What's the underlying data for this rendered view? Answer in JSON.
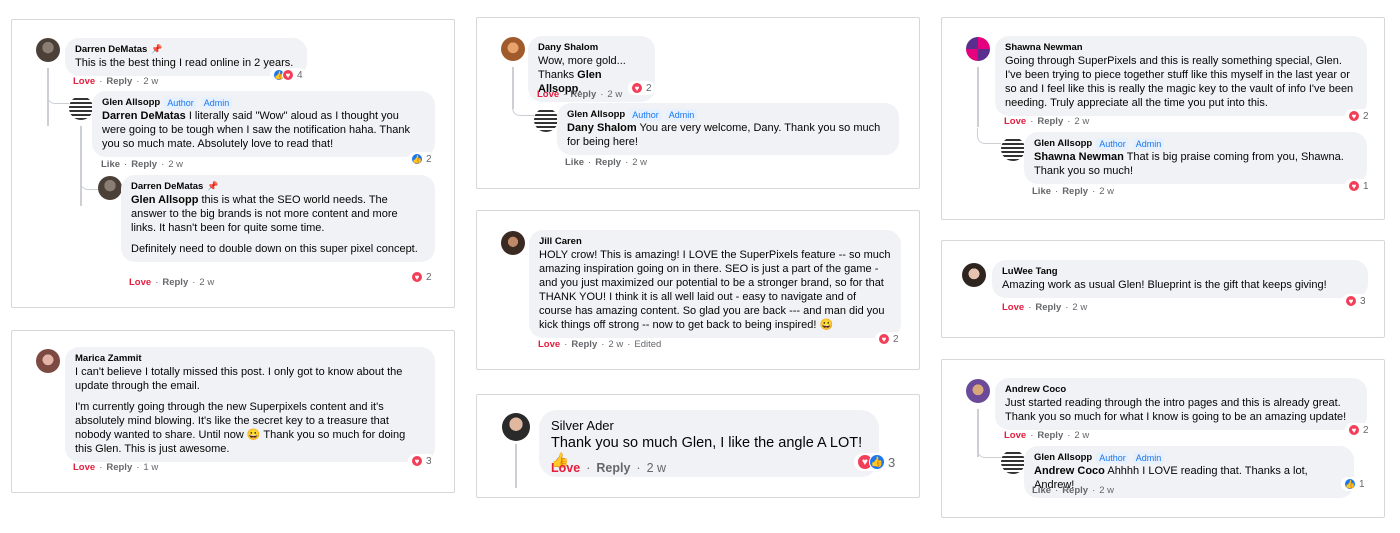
{
  "labels": {
    "love": "Love",
    "like": "Like",
    "reply": "Reply",
    "author": "Author",
    "admin": "Admin",
    "edited": "Edited",
    "sep": "·"
  },
  "c1": {
    "name": "Darren DeMatas",
    "text": "This is the best thing I read online in 2 years.",
    "time": "2 w",
    "count": "4",
    "r1": {
      "name": "Glen Allsopp",
      "mention": "Darren DeMatas",
      "text": " I literally said \"Wow\" aloud as I thought you were going to be tough when I saw the notification haha. Thank you so much mate. Absolutely love to read that!",
      "time": "2 w",
      "count": "2"
    },
    "r2": {
      "name": "Darren DeMatas",
      "mention": "Glen Allsopp",
      "text": " this is what the SEO world needs. The answer to the big brands is not more content and more links. It hasn't been for quite some time.",
      "para": "Definitely need to double down on this super pixel concept.",
      "time": "2 w",
      "count": "2"
    }
  },
  "c2": {
    "name": "Marica Zammit",
    "text": "I can't believe I totally missed this post. I only got to know about the update through the email.",
    "para": "I'm currently going through the new Superpixels content and it's absolutely mind blowing. It's like the secret key to a treasure that nobody wanted to share. Until now 😀 Thank you so much for doing this Glen. This is just awesome.",
    "time": "1 w",
    "count": "3"
  },
  "c3": {
    "name": "Dany Shalom",
    "text": "Wow, more gold...",
    "text2": "Thanks ",
    "mention": "Glen Allsopp",
    "text3": ".",
    "time": "2 w",
    "count": "2",
    "r1": {
      "name": "Glen Allsopp",
      "mention": "Dany Shalom",
      "text": " You are very welcome, Dany. Thank you so much for being here!",
      "time": "2 w"
    }
  },
  "c4": {
    "name": "Jill Caren",
    "text": "HOLY crow! This is amazing! I LOVE the SuperPixels feature -- so much amazing inspiration going on in there. SEO is just a part of the game - and you just maximized our potential to be a stronger brand, so for that THANK YOU! I think it is all well laid out - easy to navigate and of course has amazing content. So glad you are back --- and man did you kick things off strong -- now to get back to being inspired! 😀",
    "time": "2 w",
    "count": "2"
  },
  "c5": {
    "name": "Silver Ader",
    "text": "Thank you so much Glen, I like the angle A LOT! 👍",
    "time": "2 w",
    "count": "3"
  },
  "c6": {
    "name": "Shawna Newman",
    "text": "Going through SuperPixels and this is really something special, Glen. I've been trying to piece together stuff like this myself in the last year or so and I feel like this is really the magic key to the vault of info I've been needing. Truly appreciate all the time you put into this.",
    "time": "2 w",
    "count": "2",
    "r1": {
      "name": "Glen Allsopp",
      "mention": "Shawna Newman",
      "text": " That is big praise coming from you, Shawna. Thank you so much!",
      "time": "2 w",
      "count": "1"
    }
  },
  "c7": {
    "name": "LuWee Tang",
    "text": "Amazing work as usual Glen! Blueprint is the gift that keeps giving!",
    "time": "2 w",
    "count": "3"
  },
  "c8": {
    "name": "Andrew Coco",
    "text": "Just started reading through the intro pages and this is already great. Thank you so much for what I know is going to be an amazing update!",
    "time": "2 w",
    "count": "2",
    "r1": {
      "name": "Glen Allsopp",
      "mention": "Andrew Coco",
      "text": " Ahhhh I LOVE reading that. Thanks a lot, Andrew!",
      "time": "2 w",
      "count": "1"
    }
  },
  "colors": {
    "love": "#e41e3f",
    "link": "#1877f2",
    "bubble": "#f0f2f5",
    "meta": "#65676b"
  }
}
